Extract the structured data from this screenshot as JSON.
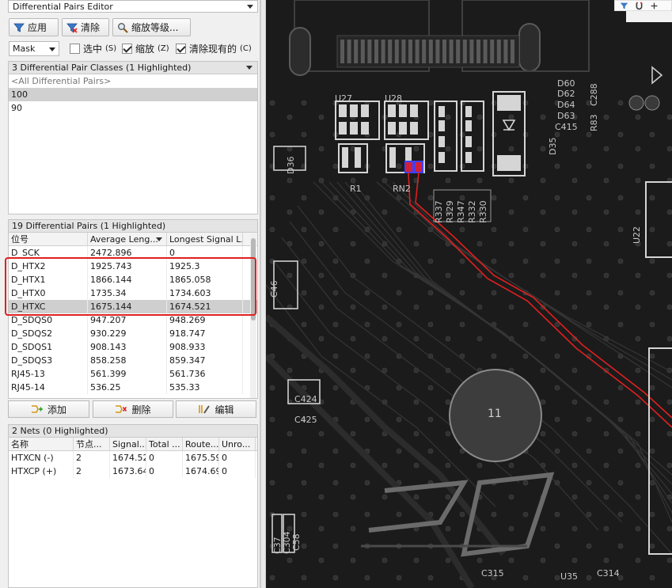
{
  "panel": {
    "title": "Differential Pairs Editor",
    "toolbar": {
      "apply": "应用",
      "clear": "清除",
      "zoom": "缩放等级..."
    },
    "mask_select": "Mask",
    "options": {
      "select": {
        "label": "选中",
        "key": "(S)",
        "checked": false
      },
      "zoom": {
        "label": "缩放",
        "key": "(Z)",
        "checked": true
      },
      "clear_existing": {
        "label": "清除现有的",
        "key": "(C)",
        "checked": true
      }
    },
    "classes": {
      "header": "3 Differential Pair Classes (1 Highlighted)",
      "items": [
        "<All Differential Pairs>",
        "100",
        "90"
      ]
    },
    "pairs": {
      "header": "19 Differential Pairs (1 Highlighted)",
      "columns": [
        "位号",
        "Average Leng...",
        "Longest Signal L..."
      ],
      "rows": [
        [
          "D_SCK",
          "2472.896",
          "0"
        ],
        [
          "D_HTX2",
          "1925.743",
          "1925.3"
        ],
        [
          "D_HTX1",
          "1866.144",
          "1865.058"
        ],
        [
          "D_HTX0",
          "1735.34",
          "1734.603"
        ],
        [
          "D_HTXC",
          "1675.144",
          "1674.521"
        ],
        [
          "D_SDQS0",
          "947.207",
          "948.269"
        ],
        [
          "D_SDQS2",
          "930.229",
          "918.747"
        ],
        [
          "D_SDQS1",
          "908.143",
          "908.933"
        ],
        [
          "D_SDQS3",
          "858.258",
          "859.347"
        ],
        [
          "RJ45-13",
          "561.399",
          "561.736"
        ],
        [
          "RJ45-14",
          "536.25",
          "535.33"
        ]
      ],
      "actions": {
        "add": "添加",
        "delete": "删除",
        "edit": "编辑"
      }
    },
    "nets": {
      "header": "2 Nets (0 Highlighted)",
      "columns": [
        "名称",
        "节点...",
        "Signal...",
        "Total ...",
        "Route...",
        "Unro..."
      ],
      "rows": [
        [
          "HTXCN (-)",
          "2",
          "1674.52",
          "0",
          "1675.59",
          "0"
        ],
        [
          "HTXCP (+)",
          "2",
          "1673.64",
          "0",
          "1674.69",
          "0"
        ]
      ]
    }
  },
  "pcb": {
    "labels": {
      "u27": "U27",
      "u28": "U28",
      "r1": "R1",
      "rn2": "RN2",
      "d36": "D36",
      "d35": "D35",
      "d60": "D60",
      "d62": "D62",
      "d64": "D64",
      "d63": "D63",
      "c415": "C415",
      "r83": "R83",
      "c288": "C288",
      "r337": "R337",
      "r329": "R329",
      "r347": "R347",
      "r332": "R332",
      "r330": "R330",
      "u22": "U22",
      "c46": "C46",
      "c424": "C424",
      "c425": "C425",
      "c315": "C315",
      "u35": "U35",
      "c314": "C314",
      "c304": "C304",
      "c58": "C58",
      "c37": "C37",
      "hole": "11"
    },
    "colors": {
      "board": "#1b1b1b",
      "trace": "#e0201e",
      "pad": "#d5d5d5",
      "silk": "#c8c8c8"
    }
  }
}
